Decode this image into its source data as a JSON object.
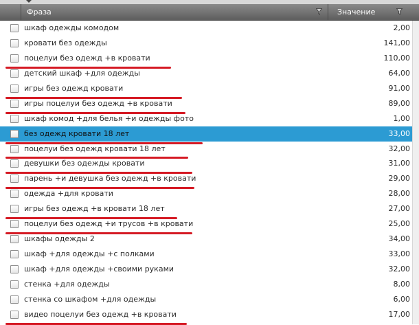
{
  "header": {
    "phrase_label": "Фраза",
    "value_label": "Значение"
  },
  "rows": [
    {
      "phrase": "шкаф одежды комодом",
      "value": "2,00"
    },
    {
      "phrase": "кровати без одежды",
      "value": "141,00"
    },
    {
      "phrase": "поцелуи без одежд +в кровати",
      "value": "110,00"
    },
    {
      "phrase": "детский шкаф +для одежды",
      "value": "64,00"
    },
    {
      "phrase": "игры без одежд кровати",
      "value": "91,00"
    },
    {
      "phrase": "игры поцелуи без одежд +в кровати",
      "value": "89,00"
    },
    {
      "phrase": "шкаф комод +для белья +и одежды фото",
      "value": "1,00"
    },
    {
      "phrase": "без одежд кровати 18 лет",
      "value": "33,00"
    },
    {
      "phrase": "поцелуи без одежд кровати 18 лет",
      "value": "32,00"
    },
    {
      "phrase": "девушки без одежды кровати",
      "value": "31,00"
    },
    {
      "phrase": "парень +и девушка без одежд +в кровати",
      "value": "29,00"
    },
    {
      "phrase": "одежда +для кровати",
      "value": "28,00"
    },
    {
      "phrase": "игры без одежд +в кровати 18 лет",
      "value": "27,00"
    },
    {
      "phrase": "поцелуи без одежд +и трусов +в кровати",
      "value": "25,00"
    },
    {
      "phrase": "шкафы одежды 2",
      "value": "34,00"
    },
    {
      "phrase": "шкаф +для одежды +с полками",
      "value": "33,00"
    },
    {
      "phrase": "шкаф +для одежды +своими руками",
      "value": "32,00"
    },
    {
      "phrase": "стенка +для одежды",
      "value": "8,00"
    },
    {
      "phrase": "стенка со шкафом +для одежды",
      "value": "6,00"
    },
    {
      "phrase": "видео поцелуи без одежд +в кровати",
      "value": "17,00"
    }
  ],
  "selected_row_color": "#2c9bd3",
  "underline_color": "#d51a24"
}
